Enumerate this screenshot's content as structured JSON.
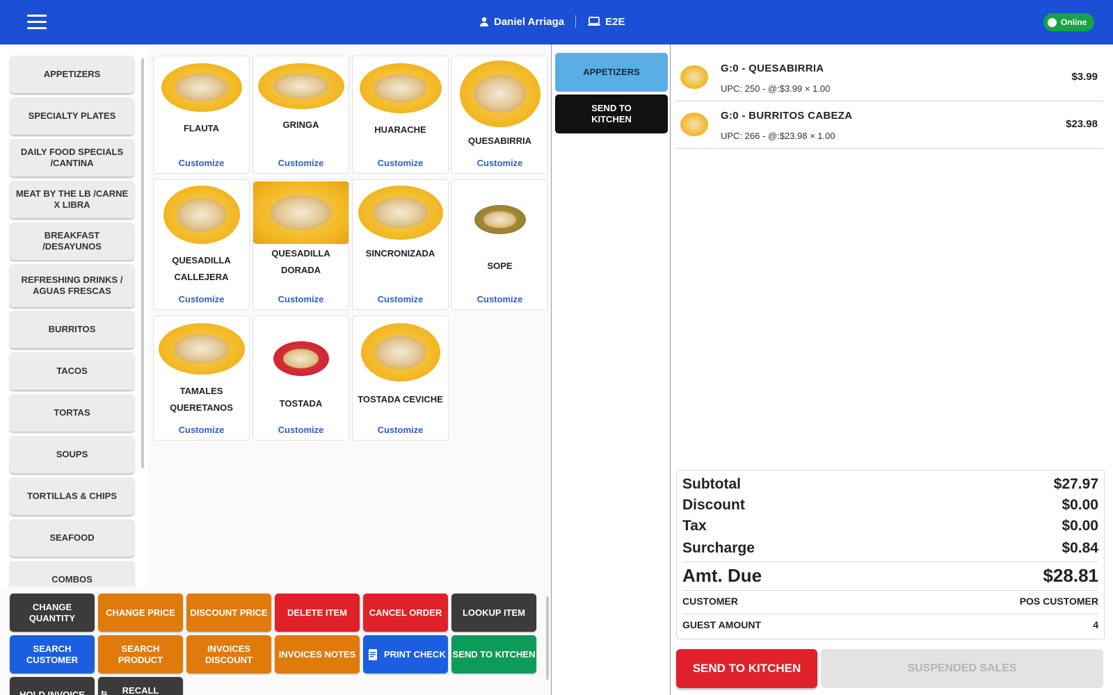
{
  "header": {
    "menu_icon": "hamburger-menu-icon",
    "user_icon": "person-icon",
    "user_name": "Daniel Arriaga",
    "device_icon": "laptop-icon",
    "device_name": "E2E",
    "status": "Online",
    "bg_color": "#1a4fd6",
    "status_color": "#16a34a"
  },
  "categories": [
    "APPETIZERS",
    "SPECIALTY PLATES",
    "DAILY FOOD SPECIALS /CANTINA",
    "MEAT BY THE LB /CARNE X LIBRA",
    "BREAKFAST /DESAYUNOS",
    "REFRESHING DRINKS / AGUAS FRESCAS",
    "BURRITOS",
    "TACOS",
    "TORTAS",
    "SOUPS",
    "TORTILLAS & CHIPS",
    "SEAFOOD",
    "COMBOS"
  ],
  "products": [
    {
      "name": "FLAUTA",
      "customize": "Customize"
    },
    {
      "name": "GRINGA",
      "customize": "Customize"
    },
    {
      "name": "HUARACHE",
      "customize": "Customize"
    },
    {
      "name": "QUESABIRRIA",
      "customize": "Customize"
    },
    {
      "name": "QUESADILLA CALLEJERA",
      "customize": "Customize"
    },
    {
      "name": "QUESADILLA DORADA",
      "customize": "Customize"
    },
    {
      "name": "SINCRONIZADA",
      "customize": "Customize"
    },
    {
      "name": "SOPE",
      "customize": "Customize"
    },
    {
      "name": "TAMALES QUERETANOS",
      "customize": "Customize"
    },
    {
      "name": "TOSTADA",
      "customize": "Customize"
    },
    {
      "name": "TOSTADA CEVICHE",
      "customize": "Customize"
    }
  ],
  "groups": {
    "active": "APPETIZERS",
    "send": "SEND TO KITCHEN",
    "active_color": "#5aaee6"
  },
  "actions": {
    "change_quantity": "CHANGE QUANTITY",
    "change_price": "CHANGE PRICE",
    "discount_price": "DISCOUNT PRICE",
    "delete_item": "DELETE ITEM",
    "cancel_order": "CANCEL ORDER",
    "lookup_item": "LOOKUP ITEM",
    "search_customer": "SEARCH CUSTOMER",
    "search_product": "SEARCH PRODUCT",
    "invoices_discount": "INVOICES DISCOUNT",
    "invoices_notes": "INVOICES NOTES",
    "print_check": "PRINT CHECK",
    "send_to_kitchen": "SEND TO KITCHEN",
    "hold_invoice": "HOLD INVOICE",
    "recall": "RECALL"
  },
  "order": {
    "lines": [
      {
        "title": "G:0 - QUESABIRRIA",
        "detail": "UPC: 250 - @:$3.99 × 1.00",
        "price": "$3.99"
      },
      {
        "title": "G:0 - BURRITOS CABEZA",
        "detail": "UPC: 266 - @:$23.98 × 1.00",
        "price": "$23.98"
      }
    ],
    "totals": {
      "subtotal_label": "Subtotal",
      "subtotal": "$27.97",
      "discount_label": "Discount",
      "discount": "$0.00",
      "tax_label": "Tax",
      "tax": "$0.00",
      "surcharge_label": "Surcharge",
      "surcharge": "$0.84",
      "amt_due_label": "Amt. Due",
      "amt_due": "$28.81",
      "customer_label": "CUSTOMER",
      "customer": "POS CUSTOMER",
      "guest_label": "GUEST AMOUNT",
      "guest": "4"
    },
    "send_to_kitchen": "SEND TO KITCHEN",
    "suspended_sales": "SUSPENDED SALES"
  }
}
